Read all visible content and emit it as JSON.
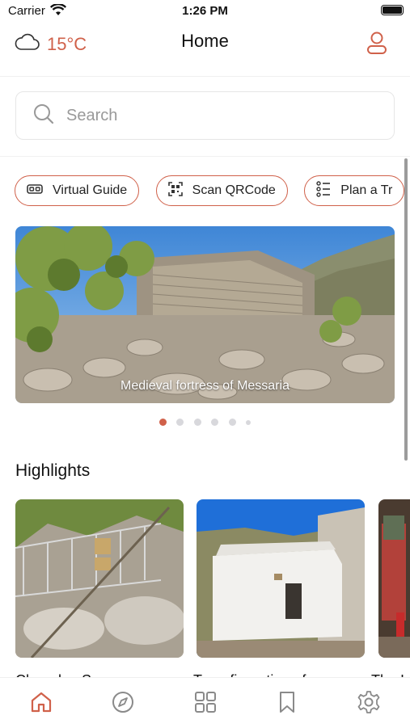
{
  "status": {
    "carrier": "Carrier",
    "time": "1:26 PM"
  },
  "header": {
    "title": "Home",
    "temperature": "15°C",
    "weather_icon": "cloud-icon",
    "profile_icon": "user-icon"
  },
  "search": {
    "placeholder": "Search"
  },
  "chips": [
    {
      "label": "Virtual Guide",
      "icon": "vr-headset-icon"
    },
    {
      "label": "Scan QRCode",
      "icon": "qr-code-icon"
    },
    {
      "label": "Plan a Tr",
      "icon": "list-plan-icon"
    }
  ],
  "hero": {
    "caption": "Medieval fortress of Messaria",
    "slide_count": 6,
    "active_slide": 1
  },
  "highlights": {
    "title": "Highlights",
    "card_titles": [
      "Chapel ... S",
      "Transfiguration of",
      "The I"
    ]
  },
  "tabs": [
    {
      "name": "home",
      "icon": "home-icon",
      "active": true
    },
    {
      "name": "explore",
      "icon": "compass-icon",
      "active": false
    },
    {
      "name": "categories",
      "icon": "grid-icon",
      "active": false
    },
    {
      "name": "saved",
      "icon": "bookmark-icon",
      "active": false
    },
    {
      "name": "settings",
      "icon": "gear-icon",
      "active": false
    }
  ],
  "colors": {
    "accent": "#d0614a",
    "inactive_icon": "#8a8a8a"
  }
}
